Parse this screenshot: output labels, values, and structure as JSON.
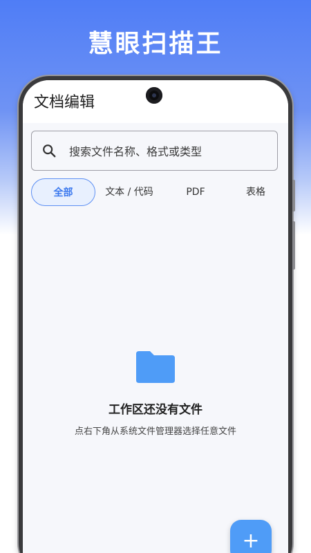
{
  "promo": {
    "title": "慧眼扫描王"
  },
  "appbar": {
    "title": "文档编辑"
  },
  "search": {
    "placeholder": "搜索文件名称、格式或类型"
  },
  "tabs": [
    {
      "label": "全部",
      "active": true
    },
    {
      "label": "文本 / 代码",
      "active": false
    },
    {
      "label": "PDF",
      "active": false
    },
    {
      "label": "表格",
      "active": false
    }
  ],
  "empty_state": {
    "title": "工作区还没有文件",
    "subtitle": "点右下角从系统文件管理器选择任意文件"
  },
  "fab": {
    "label": "+"
  },
  "colors": {
    "accent": "#3a78ee",
    "folder": "#4f9cf7",
    "fab": "#4f9cf7",
    "active_tab_bg": "#e8f0fe"
  },
  "icons": {
    "search": "search-icon",
    "folder": "folder-icon",
    "add": "plus-icon"
  }
}
